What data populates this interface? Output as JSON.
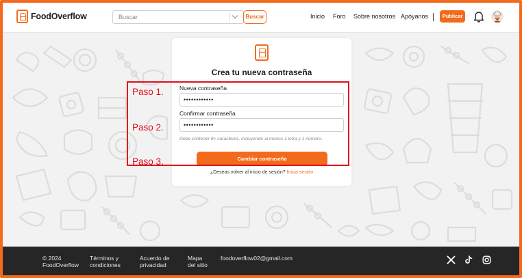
{
  "header": {
    "brand": "FoodOverflow",
    "search_placeholder": "Buscar",
    "search_button": "Buscar",
    "nav": [
      "Inicio",
      "Foro",
      "Sobre nosotros",
      "Apóyanos"
    ],
    "publish_button": "Publicar"
  },
  "card": {
    "title": "Crea tu nueva contraseña",
    "new_password_label": "Nueva contraseña",
    "new_password_value": "••••••••••••",
    "confirm_password_label": "Confirmar contraseña",
    "confirm_password_value": "••••••••••••",
    "hint": "Debe contener 8+ caracteres, incluyendo al menos 1 letra y 1 número.",
    "submit_button": "Cambiar contraseña",
    "login_prompt": "¿Deseas volver al inicio de sesión?",
    "login_link": "Inicia sesión"
  },
  "annotations": {
    "steps": [
      "Paso 1.",
      "Paso 2.",
      "Paso 3."
    ]
  },
  "footer": {
    "copyright": "© 2024\nFoodOverflow",
    "terms": "Términos y\ncondiciones",
    "privacy": "Acuerdo de\nprivacidad",
    "sitemap": "Mapa\ndel sitio",
    "email": "foodoverflow02@gmail.com",
    "social_icons": [
      "x-icon",
      "tiktok-icon",
      "instagram-icon"
    ]
  },
  "colors": {
    "accent": "#f26b1d",
    "annotation": "#e30e1c",
    "footer_bg": "#262626"
  }
}
